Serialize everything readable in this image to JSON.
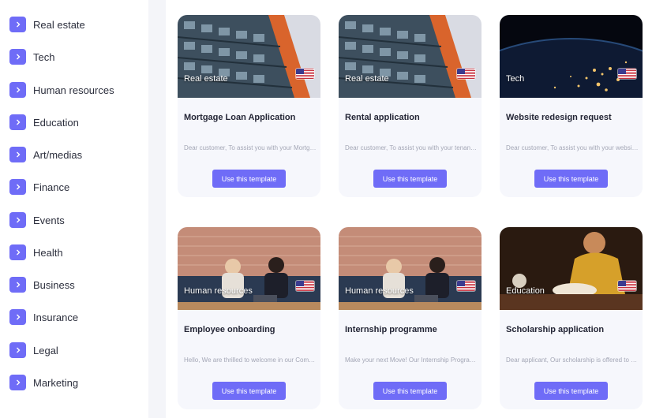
{
  "sidebar": {
    "items": [
      {
        "label": "Real estate"
      },
      {
        "label": "Tech"
      },
      {
        "label": "Human resources"
      },
      {
        "label": "Education"
      },
      {
        "label": "Art/medias"
      },
      {
        "label": "Finance"
      },
      {
        "label": "Events"
      },
      {
        "label": "Health"
      },
      {
        "label": "Business"
      },
      {
        "label": "Insurance"
      },
      {
        "label": "Legal"
      },
      {
        "label": "Marketing"
      }
    ]
  },
  "templates": [
    {
      "category": "Real estate",
      "title": "Mortgage Loan Application",
      "excerpt": "Dear customer, To assist you with your Mortgage Loan Application",
      "button": "Use this template",
      "flag_icon": "us-flag-icon"
    },
    {
      "category": "Real estate",
      "title": "Rental application",
      "excerpt": "Dear customer, To assist you with your tenancy application",
      "button": "Use this template",
      "flag_icon": "us-flag-icon"
    },
    {
      "category": "Tech",
      "title": "Website redesign request",
      "excerpt": "Dear customer, To assist you with your website redesign",
      "button": "Use this template",
      "flag_icon": "us-flag-icon"
    },
    {
      "category": "Human resources",
      "title": "Employee onboarding",
      "excerpt": "Hello, We are thrilled to welcome in our Company",
      "button": "Use this template",
      "flag_icon": "us-flag-icon"
    },
    {
      "category": "Human resources",
      "title": "Internship programme",
      "excerpt": "Make your next Move! Our Internship Programme",
      "button": "Use this template",
      "flag_icon": "us-flag-icon"
    },
    {
      "category": "Education",
      "title": "Scholarship application",
      "excerpt": "Dear applicant, Our scholarship is offered to students",
      "button": "Use this template",
      "flag_icon": "us-flag-icon"
    }
  ],
  "colors": {
    "accent": "#6f6cf7",
    "card_bg": "#f6f7fc",
    "page_bg": "#eef0f6"
  }
}
